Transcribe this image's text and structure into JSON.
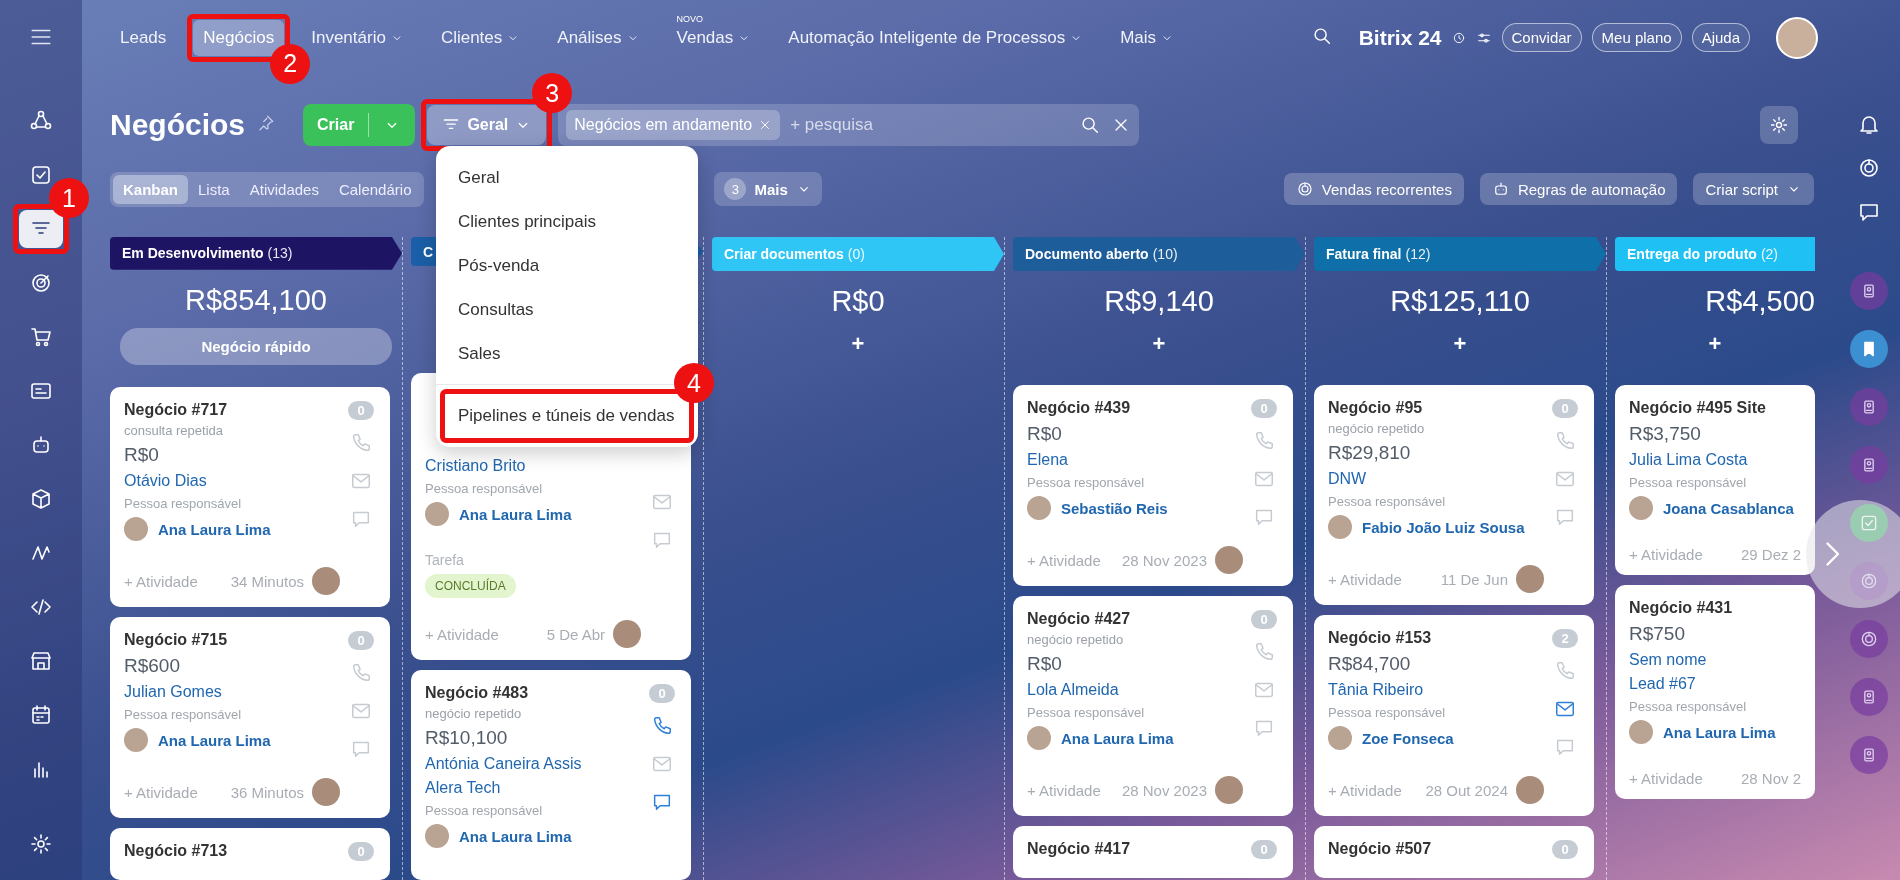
{
  "top_nav": {
    "items": [
      {
        "label": "Leads",
        "selected": false,
        "dropdown": false
      },
      {
        "label": "Negócios",
        "selected": true,
        "dropdown": false
      },
      {
        "label": "Inventário",
        "selected": false,
        "dropdown": true
      },
      {
        "label": "Clientes",
        "selected": false,
        "dropdown": true
      },
      {
        "label": "Análises",
        "selected": false,
        "dropdown": true
      },
      {
        "label": "Vendas",
        "selected": false,
        "dropdown": true,
        "badge": "NOVO"
      },
      {
        "label": "Automação Inteligente de Processos",
        "selected": false,
        "dropdown": true
      },
      {
        "label": "Mais",
        "selected": false,
        "dropdown": true
      }
    ],
    "logo": "Bitrix 24",
    "buttons": [
      "Convidar",
      "Meu plano",
      "Ajuda"
    ]
  },
  "sidebar": {
    "items": [
      {
        "selected": false
      },
      {
        "selected": false
      },
      {
        "selected": true
      },
      {
        "selected": false
      },
      {
        "selected": false
      },
      {
        "selected": false
      },
      {
        "selected": false
      },
      {
        "selected": false
      },
      {
        "selected": false
      },
      {
        "selected": false
      },
      {
        "selected": false
      },
      {
        "selected": false
      },
      {
        "selected": false
      }
    ]
  },
  "header": {
    "title": "Negócios",
    "create_button": "Criar",
    "filter_button": "Geral",
    "search": {
      "tag": "Negócios em andamento",
      "placeholder": "+ pesquisa"
    }
  },
  "view_tabs": [
    {
      "label": "Kanban",
      "selected": true
    },
    {
      "label": "Lista",
      "selected": false
    },
    {
      "label": "Atividades",
      "selected": false
    },
    {
      "label": "Calendário",
      "selected": false
    }
  ],
  "more": {
    "count": "3",
    "label": "Mais"
  },
  "toolbar_buttons": [
    "Vendas recorrentes",
    "Regras de automação",
    "Criar script"
  ],
  "dropdown_menu": {
    "items": [
      "Geral",
      "Clientes principais",
      "Pós-venda",
      "Consultas",
      "Sales"
    ],
    "footer_item": "Pipelines e túneis de vendas"
  },
  "columns": [
    {
      "title": "Em Desenvolvimento",
      "count": "(13)",
      "color": "#1e1464",
      "total": "R$854,100",
      "quick_add": "Negócio rápido",
      "cards": [
        {
          "title": "Negócio #717",
          "count": "0",
          "subtitle": "consulta repetida",
          "amount": "R$0",
          "clients": [
            "Otávio Dias"
          ],
          "responsible_label": "Pessoa responsável",
          "responsible": "Ana Laura Lima",
          "activity": "+ Atividade",
          "date": "34 Minutos",
          "phone_active": false,
          "mail_active": false,
          "chat_active": false
        },
        {
          "title": "Negócio #715",
          "count": "0",
          "amount": "R$600",
          "clients": [
            "Julian Gomes"
          ],
          "responsible_label": "Pessoa responsável",
          "responsible": "Ana Laura Lima",
          "activity": "+ Atividade",
          "date": "36 Minutos",
          "phone_active": false,
          "mail_active": false,
          "chat_active": false
        },
        {
          "title": "Negócio #713",
          "count": "0"
        }
      ]
    },
    {
      "title": "C",
      "color": "#1b5fa8",
      "cards": [
        {
          "clients": [
            "Cristiano Brito"
          ],
          "responsible_label": "Pessoa responsável",
          "responsible": "Ana Laura Lima",
          "task_label": "Tarefa",
          "task_status": "CONCLUÍDA",
          "activity": "+ Atividade",
          "date": "5 De Abr",
          "mail_active": false,
          "chat_active": false
        },
        {
          "title": "Negócio #483",
          "count": "0",
          "subtitle": "negócio repetido",
          "amount": "R$10,100",
          "clients": [
            "Antónia Caneira Assis",
            "Alera Tech"
          ],
          "responsible_label": "Pessoa responsável",
          "responsible": "Ana Laura Lima",
          "phone_active": true,
          "mail_active": false,
          "chat_active": true
        }
      ]
    },
    {
      "title": "Criar documentos",
      "count": "(0)",
      "color": "#2fc6f6",
      "total": "R$0",
      "quick_add": "+"
    },
    {
      "title": "Documento aberto",
      "count": "(10)",
      "color": "#1d5d99",
      "total": "R$9,140",
      "quick_add": "+",
      "cards": [
        {
          "title": "Negócio #439",
          "count": "0",
          "amount": "R$0",
          "clients": [
            "Elena"
          ],
          "responsible_label": "Pessoa responsável",
          "responsible": "Sebastião Reis",
          "activity": "+ Atividade",
          "date": "28 Nov 2023",
          "phone_active": false,
          "mail_active": false,
          "chat_active": false
        },
        {
          "title": "Negócio #427",
          "count": "0",
          "subtitle": "negócio repetido",
          "amount": "R$0",
          "clients": [
            "Lola Almeida"
          ],
          "responsible_label": "Pessoa responsável",
          "responsible": "Ana Laura Lima",
          "activity": "+ Atividade",
          "date": "28 Nov 2023",
          "phone_active": false,
          "mail_active": false,
          "chat_active": false
        },
        {
          "title": "Negócio #417",
          "count": "0"
        }
      ]
    },
    {
      "title": "Fatura final",
      "count": "(12)",
      "color": "#0f6fa8",
      "total": "R$125,110",
      "quick_add": "+",
      "cards": [
        {
          "title": "Negócio #95",
          "count": "0",
          "subtitle": "negócio repetido",
          "amount": "R$29,810",
          "clients": [
            "DNW"
          ],
          "responsible_label": "Pessoa responsável",
          "responsible": "Fabio João Luiz Sousa",
          "activity": "+ Atividade",
          "date": "11 De Jun",
          "phone_active": false,
          "mail_active": false,
          "chat_active": false
        },
        {
          "title": "Negócio #153",
          "count": "2",
          "amount": "R$84,700",
          "clients": [
            "Tânia Ribeiro"
          ],
          "responsible_label": "Pessoa responsável",
          "responsible": "Zoe Fonseca",
          "activity": "+ Atividade",
          "date": "28 Out 2024",
          "phone_active": false,
          "mail_active": true,
          "chat_active": false
        },
        {
          "title": "Negócio #507",
          "count": "0"
        }
      ]
    },
    {
      "title": "Entrega do produto",
      "count": "(2)",
      "color": "#1fc0f4",
      "total": "R$4,500",
      "quick_add": "+",
      "cut": true,
      "cards": [
        {
          "title": "Negócio #495 Site",
          "amount": "R$3,750",
          "clients": [
            "Julia Lima Costa"
          ],
          "responsible_label": "Pessoa responsável",
          "responsible": "Joana Casablanca",
          "activity": "+ Atividade",
          "date": "29 Dez 2"
        },
        {
          "title": "Negócio #431",
          "amount": "R$750",
          "clients": [
            "Sem nome",
            "Lead #67"
          ],
          "responsible_label": "Pessoa responsável",
          "responsible": "Ana Laura Lima",
          "activity": "+ Atividade",
          "date": "28 Nov 2"
        }
      ]
    }
  ],
  "annotations": [
    {
      "number": "1"
    },
    {
      "number": "2"
    },
    {
      "number": "3"
    },
    {
      "number": "4"
    }
  ]
}
